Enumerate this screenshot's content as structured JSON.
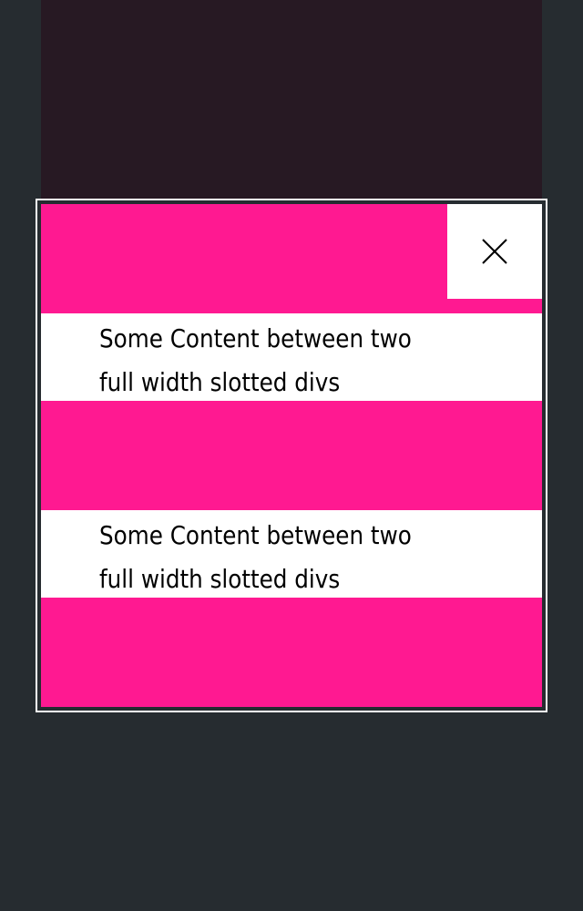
{
  "modal": {
    "close_icon": "close-icon",
    "colors": {
      "accent": "#ff1991",
      "surface": "#ffffff",
      "page_background": "#262c30",
      "backdrop": "#271923"
    },
    "blocks": [
      {
        "line1": "Some Content between two",
        "line2": "full width slotted divs"
      },
      {
        "line1": "Some Content between two",
        "line2": "full width slotted divs"
      }
    ]
  }
}
